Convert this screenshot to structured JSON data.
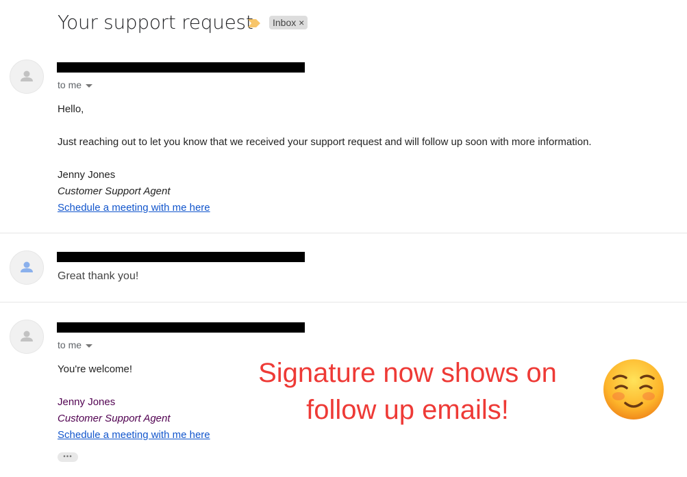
{
  "thread": {
    "subject": "Your support request",
    "label": "Inbox",
    "label_close": "×"
  },
  "messages": [
    {
      "recipient": "to me",
      "body": [
        "Hello,",
        "Just reaching out to let you know that we received your support request and will follow up soon with more information."
      ],
      "signature": {
        "name": "Jenny Jones",
        "title": "Customer Support Agent",
        "link": "Schedule a meeting with me here"
      }
    },
    {
      "snippet": "Great thank you!"
    },
    {
      "recipient": "to me",
      "body": [
        "You're welcome!"
      ],
      "signature": {
        "name": "Jenny Jones",
        "title": "Customer Support Agent",
        "link": "Schedule a meeting with me here"
      },
      "trimmed_content": "•••"
    }
  ],
  "annotation": {
    "text": "Signature now shows on follow up emails!",
    "color": "#ee3a36",
    "emoji": "smiling-face-with-smiling-eyes"
  },
  "colors": {
    "link": "#1155cc",
    "quoted_signature": "#500050",
    "importance_marker": "#f7c56a"
  }
}
